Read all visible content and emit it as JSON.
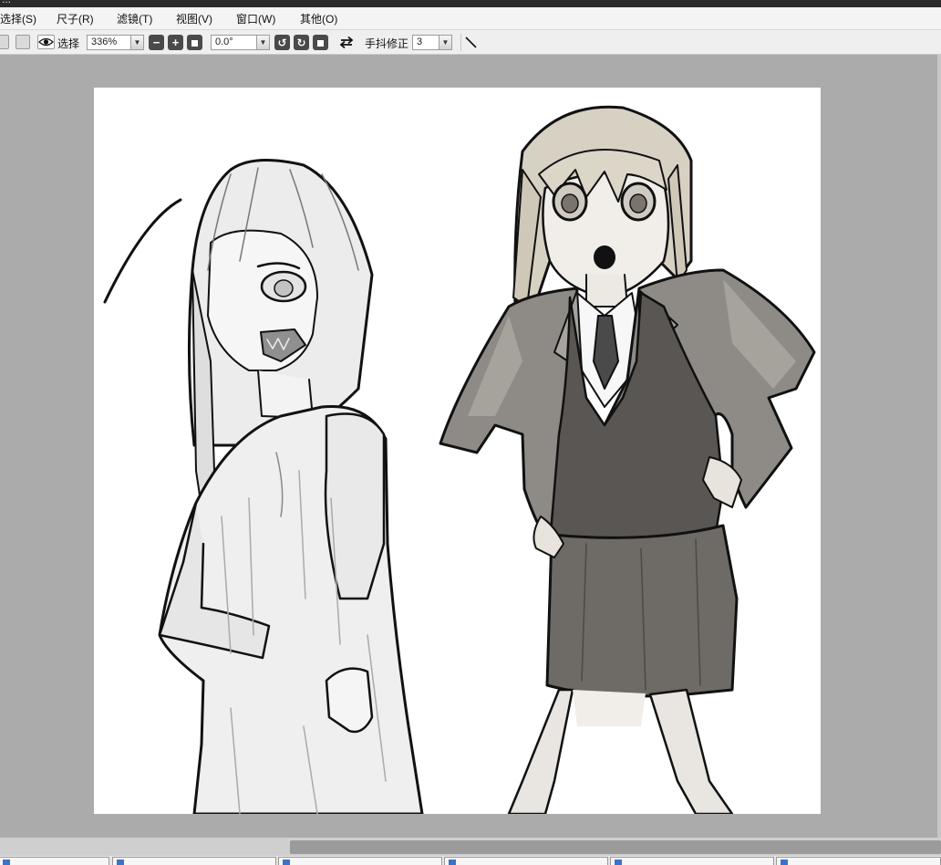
{
  "window": {
    "title": "..."
  },
  "menu": {
    "items": [
      "选择(S)",
      "尺子(R)",
      "滤镜(T)",
      "视图(V)",
      "窗口(W)",
      "其他(O)"
    ]
  },
  "toolbar": {
    "visibility_icon": "eye-icon",
    "selection_label": "选择",
    "zoom_value": "336%",
    "rotation_value": "0.0°",
    "stabilizer_label": "手抖修正",
    "stabilizer_value": "3"
  },
  "colors": {
    "background": "#ababab",
    "canvas": "#ffffff",
    "toolbar": "#efefef"
  }
}
